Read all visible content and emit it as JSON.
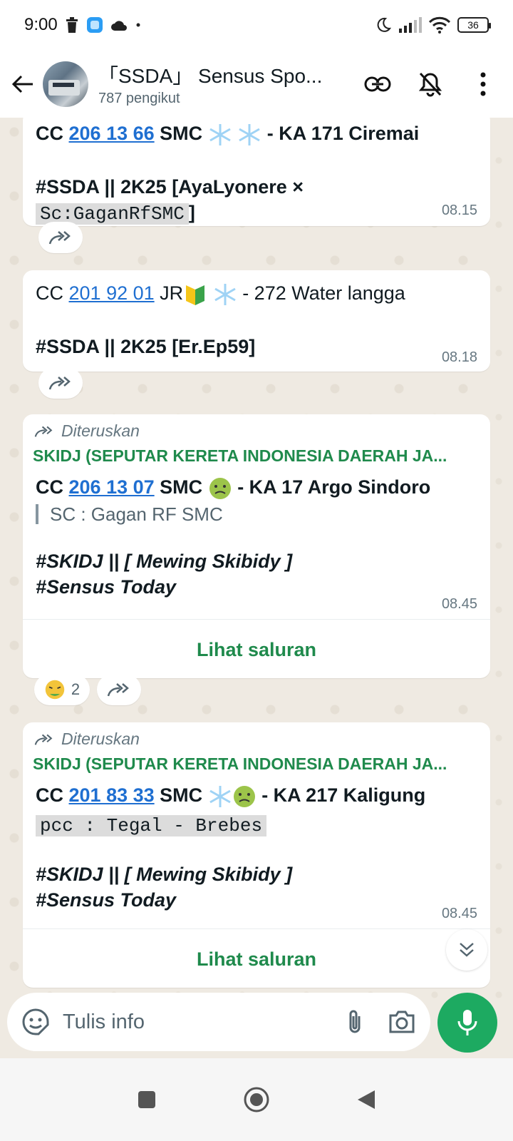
{
  "status": {
    "time": "9:00",
    "battery": "36"
  },
  "header": {
    "title": "「SSDA」 Sensus Spo...",
    "followers": "787 pengikut"
  },
  "messages": [
    {
      "cc_prefix": "CC",
      "cc_number": "206 13 66",
      "cc_type": "SMC",
      "emojis": [
        "snowflake",
        "snowflake"
      ],
      "train": "- KA 171 Ciremai",
      "tag": "#SSDA || 2K25 [AyaLyonere ×",
      "mono": "Sc:GaganRfSMC",
      "mono_suffix": "]",
      "time": "08.15"
    },
    {
      "cc_prefix": "CC",
      "cc_number": "201 92 01",
      "cc_type": "JR",
      "emojis": [
        "beginner",
        "snowflake"
      ],
      "train": "- 272 Water langga",
      "tag": "#SSDA || 2K25 [Er.Ep59]",
      "time": "08.18"
    },
    {
      "forwarded": "Diteruskan",
      "source": "SKIDJ (SEPUTAR KERETA INDONESIA DAERAH JA...",
      "cc_prefix": "CC",
      "cc_number": "206 13 07",
      "cc_type": "SMC",
      "emojis": [
        "nauseated"
      ],
      "train": "- KA 17 Argo Sindoro",
      "quote": "SC : Gagan RF SMC",
      "tag1": "#SKIDJ || [ Mewing Skibidy ]",
      "tag2": "#Sensus Today",
      "time": "08.45",
      "see_channel": "Lihat saluran",
      "reaction_count": "2"
    },
    {
      "forwarded": "Diteruskan",
      "source": "SKIDJ (SEPUTAR KERETA INDONESIA DAERAH JA...",
      "cc_prefix": "CC",
      "cc_number": "201 83 33",
      "cc_type": "SMC",
      "emojis": [
        "snowflake",
        "nauseated"
      ],
      "train": "- KA 217 Kaligung",
      "mono": "pcc : Tegal - Brebes",
      "tag1": "#SKIDJ || [ Mewing Skibidy ]",
      "tag2": "#Sensus Today",
      "time": "08.45",
      "see_channel": "Lihat saluran"
    }
  ],
  "input": {
    "placeholder": "Tulis info"
  },
  "colors": {
    "accent_green": "#1daa61",
    "link_blue": "#1f6fd1",
    "source_green": "#1f8a4c"
  }
}
